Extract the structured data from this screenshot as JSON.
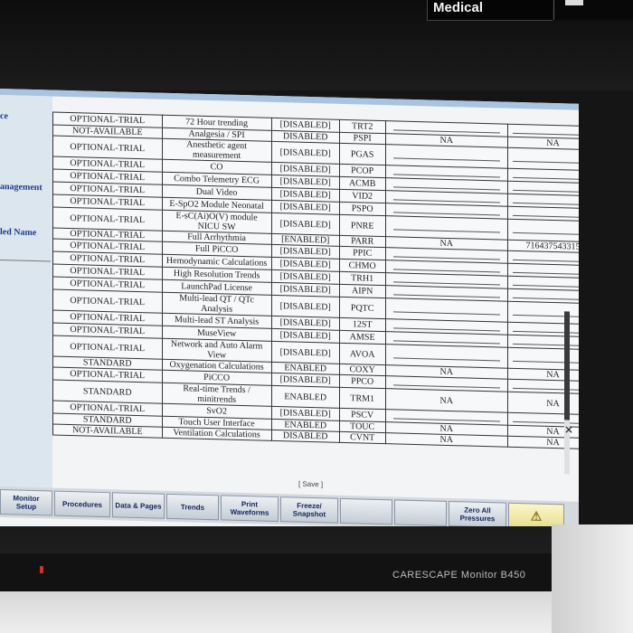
{
  "device": {
    "brand_label": "Medical",
    "model_label": "CARESCAPE Monitor B450"
  },
  "left_panel": {
    "labels": [
      "ce",
      "anagement",
      "led Name"
    ]
  },
  "table": {
    "rows": [
      [
        "OPTIONAL-TRIAL",
        "72 Hour trending",
        "[DISABLED]",
        "TRT2",
        "",
        ""
      ],
      [
        "NOT-AVAILABLE",
        "Analgesia / SPI",
        "DISABLED",
        "PSPI",
        "NA",
        "NA"
      ],
      [
        "OPTIONAL-TRIAL",
        "Anesthetic agent measurement",
        "[DISABLED]",
        "PGAS",
        "",
        ""
      ],
      [
        "OPTIONAL-TRIAL",
        "CO",
        "[DISABLED]",
        "PCOP",
        "",
        ""
      ],
      [
        "OPTIONAL-TRIAL",
        "Combo Telemetry ECG",
        "[DISABLED]",
        "ACMB",
        "",
        ""
      ],
      [
        "OPTIONAL-TRIAL",
        "Dual Video",
        "[DISABLED]",
        "VID2",
        "",
        ""
      ],
      [
        "OPTIONAL-TRIAL",
        "E-SpO2 Module Neonatal",
        "[DISABLED]",
        "PSPO",
        "",
        ""
      ],
      [
        "OPTIONAL-TRIAL",
        "E-sC(Ai)O(V) module NICU SW",
        "[DISABLED]",
        "PNRE",
        "",
        ""
      ],
      [
        "OPTIONAL-TRIAL",
        "Full Arrhythmia",
        "[ENABLED]",
        "PARR",
        "NA",
        "716437543315"
      ],
      [
        "OPTIONAL-TRIAL",
        "Full PiCCO",
        "[DISABLED]",
        "PPIC",
        "",
        ""
      ],
      [
        "OPTIONAL-TRIAL",
        "Hemodynamic Calculations",
        "[DISABLED]",
        "CHMO",
        "",
        ""
      ],
      [
        "OPTIONAL-TRIAL",
        "High Resolution Trends",
        "[DISABLED]",
        "TRH1",
        "",
        ""
      ],
      [
        "OPTIONAL-TRIAL",
        "LaunchPad License",
        "[DISABLED]",
        "AIPN",
        "",
        ""
      ],
      [
        "OPTIONAL-TRIAL",
        "Multi-lead QT / QTc Analysis",
        "[DISABLED]",
        "PQTC",
        "",
        ""
      ],
      [
        "OPTIONAL-TRIAL",
        "Multi-lead ST Analysis",
        "[DISABLED]",
        "12ST",
        "",
        ""
      ],
      [
        "OPTIONAL-TRIAL",
        "MuseView",
        "[DISABLED]",
        "AMSE",
        "",
        ""
      ],
      [
        "OPTIONAL-TRIAL",
        "Network and Auto Alarm View",
        "[DISABLED]",
        "AVOA",
        "",
        ""
      ],
      [
        "STANDARD",
        "Oxygenation Calculations",
        "ENABLED",
        "COXY",
        "NA",
        "NA"
      ],
      [
        "OPTIONAL-TRIAL",
        "PiCCO",
        "[DISABLED]",
        "PPCO",
        "",
        ""
      ],
      [
        "STANDARD",
        "Real-time Trends / minitrends",
        "ENABLED",
        "TRM1",
        "NA",
        "NA"
      ],
      [
        "OPTIONAL-TRIAL",
        "SvO2",
        "[DISABLED]",
        "PSCV",
        "",
        ""
      ],
      [
        "STANDARD",
        "Touch User Interface",
        "ENABLED",
        "TOUC",
        "NA",
        "NA"
      ],
      [
        "NOT-AVAILABLE",
        "Ventilation Calculations",
        "DISABLED",
        "CVNT",
        "NA",
        "NA"
      ]
    ]
  },
  "save_label": "[ Save ]",
  "toolbar": {
    "buttons": [
      {
        "id": "monitor-setup",
        "label": "Monitor Setup",
        "enabled": true
      },
      {
        "id": "procedures",
        "label": "Procedures",
        "enabled": true
      },
      {
        "id": "data-pages",
        "label": "Data & Pages",
        "enabled": true
      },
      {
        "id": "trends",
        "label": "Trends",
        "enabled": true
      },
      {
        "id": "print-waveforms",
        "label": "Print Waveforms",
        "enabled": true
      },
      {
        "id": "freeze-snapshot",
        "label": "Freeze/ Snapshot",
        "enabled": true
      },
      {
        "id": "blank-1",
        "label": "",
        "enabled": false
      },
      {
        "id": "blank-2",
        "label": "",
        "enabled": false
      },
      {
        "id": "zero-all-pressures",
        "label": "Zero All Pressures",
        "enabled": true
      },
      {
        "id": "alarm-silence",
        "label": "",
        "enabled": true
      }
    ]
  },
  "colors": {
    "title_blue": "#1e3a8a",
    "toolbar_text": "#14265c",
    "alarm_button": "#f0e7a8"
  }
}
